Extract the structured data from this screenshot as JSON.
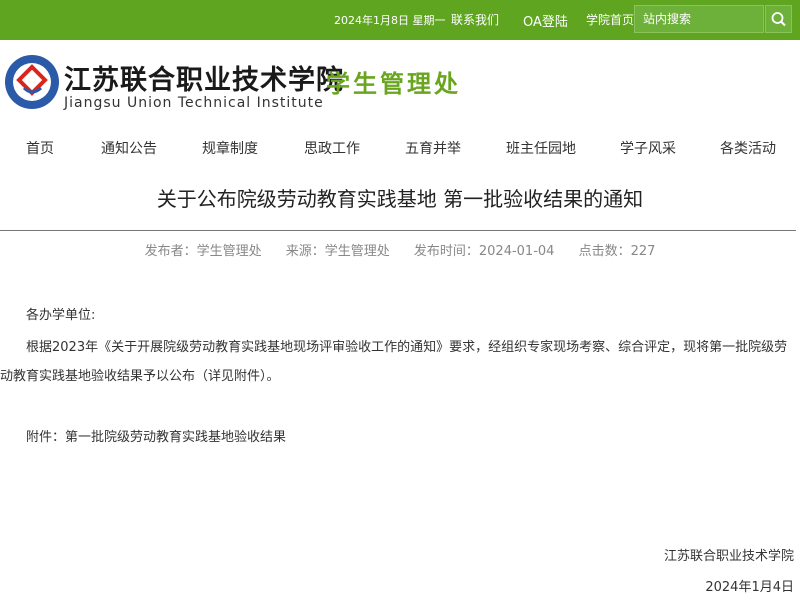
{
  "topbar": {
    "date": "2024年1月8日 星期一",
    "contact": "联系我们",
    "oa": "OA登陆",
    "home": "学院首页",
    "search_placeholder": "站内搜索"
  },
  "header": {
    "cn_name": "江苏联合职业技术学院",
    "en_name": "Jiangsu Union Technical Institute",
    "dept": "学生管理处",
    "logo_text": "江苏联合职业技术学院 Jiangsu Union Technical Institute"
  },
  "nav": [
    "首页",
    "通知公告",
    "规章制度",
    "思政工作",
    "五育并举",
    "班主任园地",
    "学子风采",
    "各类活动"
  ],
  "article": {
    "title": "关于公布院级劳动教育实践基地 第一批验收结果的通知",
    "publisher": "发布者：学生管理处",
    "source": "来源：学生管理处",
    "time": "发布时间：2024-01-04",
    "clicks": "点击数：227",
    "greeting": "各办学单位:",
    "body": "根据2023年《关于开展院级劳动教育实践基地现场评审验收工作的通知》要求，经组织专家现场考察、综合评定，现将第一批院级劳动教育实践基地验收结果予以公布（详见附件）。",
    "attachment": "附件：第一批院级劳动教育实践基地验收结果",
    "signature": "江苏联合职业技术学院",
    "sign_date": "2024年1月4日"
  },
  "colors": {
    "topbar": "#5fa520",
    "dept": "#6aa520",
    "logo": "#2a5aa8",
    "logo_red": "#d9251c"
  }
}
